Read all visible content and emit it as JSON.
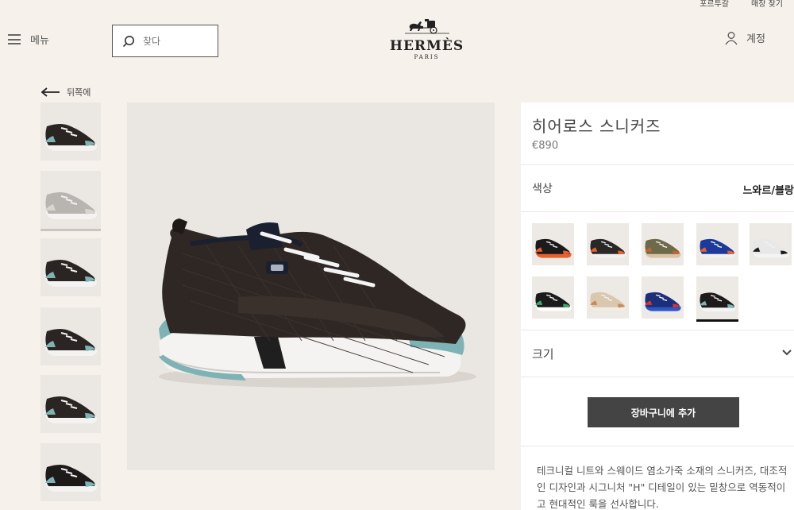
{
  "utility": {
    "link1": "포르투갈",
    "link2": "매장 찾기"
  },
  "header": {
    "menu_label": "메뉴",
    "search_placeholder": "찾다",
    "logo_word": "HERMÈS",
    "logo_sub": "PARIS",
    "account_label": "계정"
  },
  "nav": {
    "back_label": "뒤쪽에"
  },
  "product": {
    "title": "히어로스 스니커즈",
    "price": "€890",
    "color_label": "색상",
    "color_value": "느와르/블랑",
    "size_label": "크기",
    "cart_label": "장바구니에 추가",
    "description": "테크니컬 니트와 스웨이드 염소가죽 소재의 스니커즈, 대조적인 디자인과 시그니처 \"H\" 디테일이 있는 밑창으로 역동적이고 현대적인 룩을 선사합니다."
  },
  "thumbnails": [
    {
      "view": "front-angle",
      "upper": "#2a2422",
      "accent": "#7eb3b5"
    },
    {
      "view": "side-grey",
      "upper": "#b8b4b0",
      "accent": "#d8d4d0"
    },
    {
      "view": "side",
      "upper": "#2a2422",
      "accent": "#7eb3b5"
    },
    {
      "view": "side-right",
      "upper": "#2a2422",
      "accent": "#7eb3b5"
    },
    {
      "view": "pair",
      "upper": "#2a2422",
      "accent": "#7eb3b5"
    },
    {
      "view": "top",
      "upper": "#1e1a19",
      "accent": "#7eb3b5"
    }
  ],
  "swatches": [
    {
      "name": "orange-black",
      "upper": "#1b1b1b",
      "accent": "#e8602c",
      "sole": "#e8602c"
    },
    {
      "name": "orange-white",
      "upper": "#2a2727",
      "accent": "#e8602c",
      "sole": "#f0f0f0"
    },
    {
      "name": "khaki",
      "upper": "#6d6a4a",
      "accent": "#c9612f",
      "sole": "#d8c4a4"
    },
    {
      "name": "blue-orange",
      "upper": "#1d3a9a",
      "accent": "#e8602c",
      "sole": "#f0f0f0"
    },
    {
      "name": "white-black",
      "upper": "#e8e8e8",
      "accent": "#1b1b1b",
      "sole": "#f4f4f4"
    },
    {
      "name": "black-green",
      "upper": "#1b1b1b",
      "accent": "#3aa86a",
      "sole": "#ffffff"
    },
    {
      "name": "beige",
      "upper": "#d9c7ae",
      "accent": "#c98a5a",
      "sole": "#f1ece4"
    },
    {
      "name": "navy-red",
      "upper": "#1c2f7a",
      "accent": "#d8362a",
      "sole": "#2d56c9"
    },
    {
      "name": "black-teal",
      "upper": "#1e1a19",
      "accent": "#7eb3b5",
      "sole": "#f4f4f4"
    }
  ],
  "colors": {
    "background": "#f6f1eb",
    "panel": "#ffffff",
    "cart_button": "#444444",
    "selected_underline": "#111111"
  }
}
